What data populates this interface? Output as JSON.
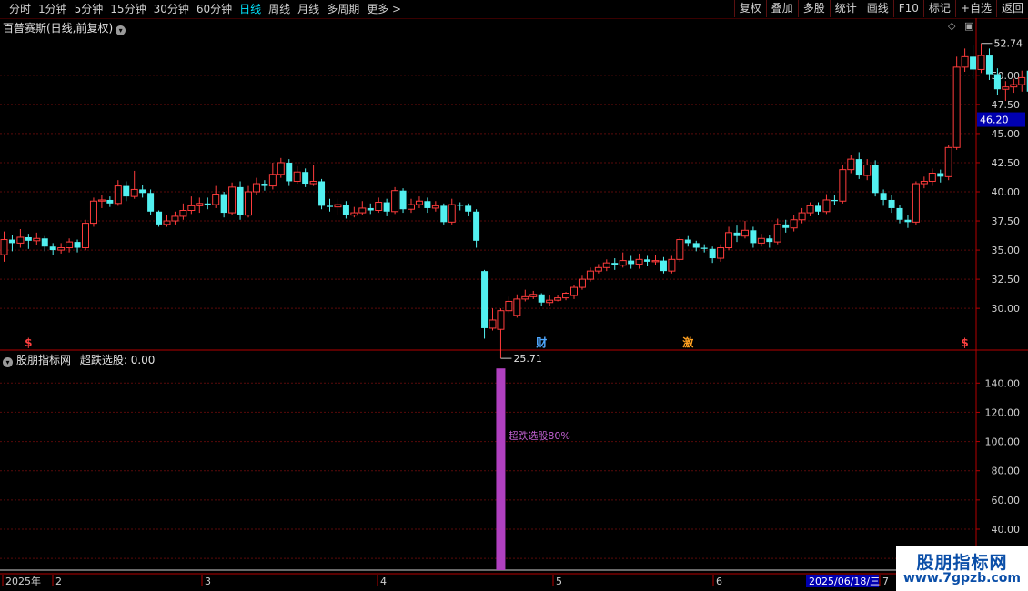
{
  "toolbar": {
    "periods": [
      "分时",
      "1分钟",
      "5分钟",
      "15分钟",
      "30分钟",
      "60分钟",
      "日线",
      "周线",
      "月线",
      "多周期",
      "更多 >"
    ],
    "active_period": "日线",
    "buttons": [
      "复权",
      "叠加",
      "多股",
      "统计",
      "画线",
      "F10",
      "标记",
      "+自选",
      "返回"
    ]
  },
  "main_title": "百普赛斯(日线,前复权)",
  "indicator_title": "股朋指标网",
  "indicator_value": "超跌选股: 0.00",
  "indicator_annotation": "超跌选股80%",
  "watermark": {
    "line1": "股朋指标网",
    "line2": "www.7gpzb.com"
  },
  "price_axis_highlight": "46.20",
  "high_label": "52.74",
  "low_label": "25.71",
  "event_markers": [
    {
      "index": 3,
      "text": "$",
      "color": "#ff4040"
    },
    {
      "index": 66,
      "text": "财",
      "color": "#4fa8ff"
    },
    {
      "index": 84,
      "text": "激",
      "color": "#ffa020"
    },
    {
      "index": 118,
      "text": "$",
      "color": "#ff4040"
    }
  ],
  "date_axis": [
    "2025年",
    "2",
    "3",
    "4",
    "5",
    "6",
    "7"
  ],
  "date_current": "2025/06/18/三",
  "colors": {
    "up": "#ff3c3c",
    "down": "#52f0f0",
    "grid": "#5a0a0a",
    "axis": "#b40000",
    "signal": "#b040c0"
  },
  "chart_data": {
    "type": "candlestick",
    "y_ticks": [
      30.0,
      32.5,
      35.0,
      37.5,
      40.0,
      42.5,
      45.0,
      47.5,
      50.0
    ],
    "ylim": [
      26.5,
      53.5
    ],
    "candles": [
      [
        34.6,
        35.9,
        34.0,
        36.6
      ],
      [
        35.9,
        35.6,
        34.9,
        36.3
      ],
      [
        35.6,
        36.1,
        35.2,
        36.8
      ],
      [
        36.1,
        35.8,
        35.1,
        36.4
      ],
      [
        35.8,
        36.0,
        35.4,
        36.5
      ],
      [
        36.0,
        35.3,
        34.9,
        36.2
      ],
      [
        35.3,
        35.0,
        34.6,
        35.6
      ],
      [
        35.0,
        35.2,
        34.7,
        35.6
      ],
      [
        35.2,
        35.7,
        34.8,
        36.0
      ],
      [
        35.7,
        35.2,
        34.8,
        35.9
      ],
      [
        35.2,
        37.3,
        35.0,
        37.6
      ],
      [
        37.3,
        39.2,
        37.0,
        39.5
      ],
      [
        39.2,
        39.3,
        38.6,
        39.7
      ],
      [
        39.3,
        39.0,
        38.7,
        39.6
      ],
      [
        39.0,
        40.5,
        38.8,
        41.0
      ],
      [
        40.5,
        39.6,
        39.2,
        40.9
      ],
      [
        39.6,
        40.2,
        39.4,
        41.8
      ],
      [
        40.2,
        39.9,
        39.5,
        40.6
      ],
      [
        39.9,
        38.3,
        38.0,
        40.2
      ],
      [
        38.3,
        37.2,
        37.0,
        38.4
      ],
      [
        37.2,
        37.5,
        37.0,
        38.0
      ],
      [
        37.5,
        37.9,
        37.2,
        38.3
      ],
      [
        37.9,
        38.4,
        37.6,
        39.0
      ],
      [
        38.4,
        38.8,
        38.1,
        39.6
      ],
      [
        38.8,
        39.0,
        38.2,
        39.5
      ],
      [
        39.0,
        38.9,
        38.5,
        39.5
      ],
      [
        38.9,
        39.8,
        38.6,
        40.5
      ],
      [
        39.8,
        38.2,
        37.8,
        40.0
      ],
      [
        38.2,
        40.4,
        38.0,
        40.8
      ],
      [
        40.4,
        38.0,
        37.6,
        40.9
      ],
      [
        38.0,
        40.0,
        37.8,
        40.5
      ],
      [
        40.0,
        40.7,
        39.7,
        41.2
      ],
      [
        40.7,
        40.5,
        40.1,
        41.0
      ],
      [
        40.5,
        41.5,
        40.2,
        42.5
      ],
      [
        41.5,
        42.5,
        41.2,
        42.9
      ],
      [
        42.5,
        40.9,
        40.5,
        42.8
      ],
      [
        40.9,
        41.7,
        40.7,
        42.2
      ],
      [
        41.7,
        40.7,
        40.4,
        42.0
      ],
      [
        40.7,
        40.9,
        40.5,
        42.3
      ],
      [
        40.9,
        38.8,
        38.5,
        41.1
      ],
      [
        38.8,
        38.7,
        38.3,
        39.4
      ],
      [
        38.7,
        38.9,
        38.0,
        39.4
      ],
      [
        38.9,
        38.0,
        37.7,
        39.2
      ],
      [
        38.0,
        38.2,
        37.8,
        38.7
      ],
      [
        38.2,
        38.6,
        38.0,
        39.2
      ],
      [
        38.6,
        38.4,
        38.1,
        39.0
      ],
      [
        38.4,
        39.1,
        38.2,
        39.5
      ],
      [
        39.1,
        38.3,
        37.9,
        39.4
      ],
      [
        38.3,
        40.1,
        38.1,
        40.4
      ],
      [
        40.1,
        38.5,
        38.2,
        40.3
      ],
      [
        38.5,
        38.9,
        38.2,
        39.4
      ],
      [
        38.9,
        39.2,
        38.6,
        39.6
      ],
      [
        39.2,
        38.6,
        38.2,
        39.5
      ],
      [
        38.6,
        38.8,
        38.3,
        39.2
      ],
      [
        38.8,
        37.4,
        37.2,
        39.0
      ],
      [
        37.4,
        38.9,
        37.2,
        39.4
      ],
      [
        38.9,
        38.8,
        38.4,
        39.1
      ],
      [
        38.8,
        38.3,
        37.9,
        39.0
      ],
      [
        38.3,
        35.8,
        35.2,
        38.5
      ],
      [
        33.2,
        28.3,
        27.4,
        33.3
      ],
      [
        28.3,
        29.0,
        28.1,
        30.0
      ],
      [
        28.2,
        29.8,
        25.71,
        30.0
      ],
      [
        29.8,
        30.6,
        29.6,
        31.0
      ],
      [
        29.4,
        30.8,
        29.2,
        31.2
      ],
      [
        30.8,
        31.0,
        30.6,
        31.6
      ],
      [
        31.0,
        31.2,
        30.8,
        31.5
      ],
      [
        31.2,
        30.5,
        30.2,
        31.3
      ],
      [
        30.5,
        30.7,
        30.2,
        31.1
      ],
      [
        30.7,
        30.9,
        30.6,
        31.1
      ],
      [
        30.9,
        31.3,
        30.7,
        31.4
      ],
      [
        31.1,
        31.8,
        30.8,
        32.0
      ],
      [
        31.8,
        32.5,
        31.6,
        32.8
      ],
      [
        32.5,
        33.2,
        32.3,
        33.5
      ],
      [
        33.2,
        33.5,
        33.0,
        33.8
      ],
      [
        33.5,
        33.9,
        33.2,
        34.2
      ],
      [
        33.9,
        33.7,
        33.3,
        34.3
      ],
      [
        33.7,
        34.1,
        33.5,
        34.8
      ],
      [
        34.1,
        33.8,
        33.4,
        34.5
      ],
      [
        33.8,
        34.2,
        33.4,
        34.7
      ],
      [
        34.2,
        34.0,
        33.6,
        34.5
      ],
      [
        34.0,
        34.1,
        33.7,
        34.6
      ],
      [
        34.1,
        33.2,
        33.0,
        34.4
      ],
      [
        33.2,
        34.2,
        33.0,
        34.5
      ],
      [
        34.2,
        35.9,
        34.0,
        36.1
      ],
      [
        35.9,
        35.6,
        35.3,
        36.2
      ],
      [
        35.6,
        35.2,
        34.9,
        35.8
      ],
      [
        35.2,
        35.1,
        34.8,
        35.5
      ],
      [
        35.1,
        34.3,
        33.9,
        35.3
      ],
      [
        34.3,
        35.2,
        34.0,
        35.5
      ],
      [
        35.2,
        36.5,
        35.0,
        37.0
      ],
      [
        36.5,
        36.2,
        35.7,
        37.1
      ],
      [
        36.2,
        36.7,
        36.0,
        37.5
      ],
      [
        36.7,
        35.6,
        35.2,
        37.0
      ],
      [
        35.6,
        36.0,
        35.3,
        36.4
      ],
      [
        36.0,
        35.7,
        35.2,
        36.3
      ],
      [
        35.7,
        37.2,
        35.5,
        37.7
      ],
      [
        37.2,
        36.9,
        36.5,
        37.6
      ],
      [
        36.9,
        37.6,
        36.6,
        38.0
      ],
      [
        37.6,
        38.2,
        37.3,
        38.6
      ],
      [
        38.2,
        38.8,
        37.9,
        39.1
      ],
      [
        38.8,
        38.3,
        38.0,
        39.1
      ],
      [
        38.3,
        39.3,
        38.1,
        39.8
      ],
      [
        39.3,
        39.2,
        38.9,
        39.7
      ],
      [
        39.2,
        41.9,
        39.0,
        42.3
      ],
      [
        41.9,
        42.8,
        41.6,
        43.2
      ],
      [
        42.8,
        41.4,
        41.1,
        43.4
      ],
      [
        41.4,
        42.3,
        41.0,
        42.8
      ],
      [
        42.3,
        39.9,
        39.6,
        42.7
      ],
      [
        39.9,
        39.3,
        38.8,
        40.2
      ],
      [
        39.3,
        38.6,
        38.2,
        39.7
      ],
      [
        38.6,
        37.6,
        37.3,
        38.9
      ],
      [
        37.6,
        37.4,
        36.9,
        38.0
      ],
      [
        37.4,
        40.7,
        37.2,
        40.9
      ],
      [
        40.7,
        40.9,
        40.3,
        41.3
      ],
      [
        40.9,
        41.6,
        40.5,
        42.0
      ],
      [
        41.6,
        41.3,
        40.8,
        41.9
      ],
      [
        41.3,
        43.8,
        41.0,
        44.0
      ],
      [
        43.8,
        50.7,
        43.6,
        51.6
      ],
      [
        50.7,
        51.6,
        50.3,
        52.3
      ],
      [
        51.6,
        50.5,
        49.7,
        52.6
      ],
      [
        50.5,
        51.7,
        50.2,
        52.74
      ],
      [
        51.7,
        50.1,
        49.6,
        52.3
      ],
      [
        50.1,
        48.8,
        48.3,
        50.6
      ],
      [
        48.8,
        49.0,
        47.8,
        49.5
      ],
      [
        49.0,
        49.2,
        48.5,
        49.7
      ],
      [
        49.2,
        49.8,
        48.6,
        50.4
      ],
      [
        50.4,
        48.6,
        48.3,
        50.5
      ],
      [
        48.6,
        50.2,
        48.0,
        50.5
      ]
    ],
    "indicator": {
      "name": "超跌选股",
      "y_ticks": [
        20.0,
        40.0,
        60.0,
        80.0,
        100.0,
        120.0,
        140.0
      ],
      "ylim": [
        12,
        152
      ],
      "signal_index": 61,
      "signal_value": 150
    }
  }
}
